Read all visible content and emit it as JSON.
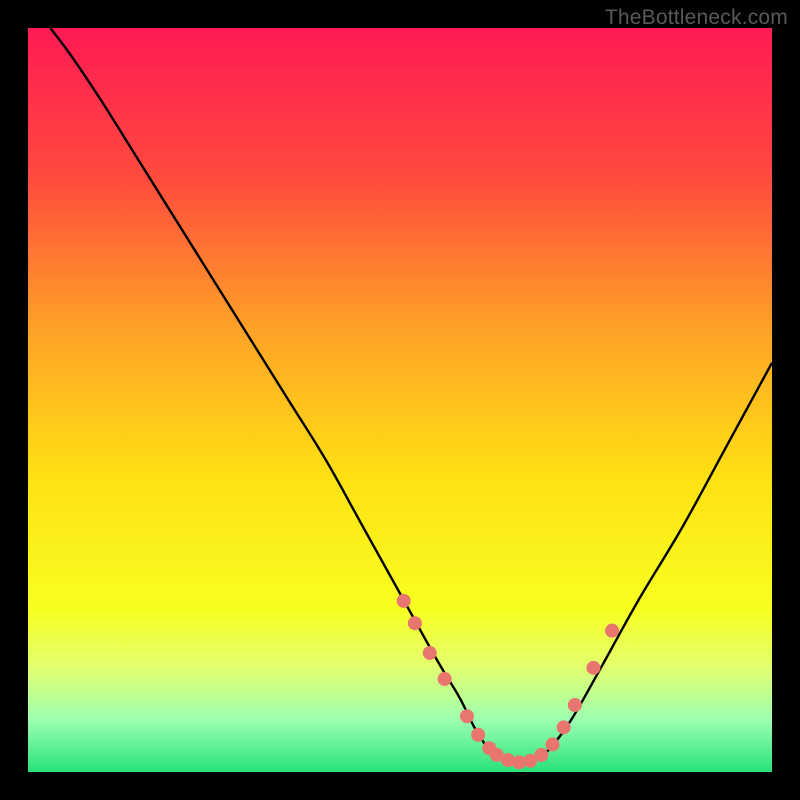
{
  "watermark": "TheBottleneck.com",
  "chart_data": {
    "type": "line",
    "title": "",
    "xlabel": "",
    "ylabel": "",
    "xlim": [
      0,
      100
    ],
    "ylim": [
      0,
      100
    ],
    "grid": false,
    "legend": false,
    "gradient_stops": [
      {
        "offset": 0,
        "color": "#ff1a54"
      },
      {
        "offset": 20,
        "color": "#ff4a3e"
      },
      {
        "offset": 40,
        "color": "#ffa028"
      },
      {
        "offset": 60,
        "color": "#ffe014"
      },
      {
        "offset": 78,
        "color": "#f8ff20"
      },
      {
        "offset": 86,
        "color": "#e2ff70"
      },
      {
        "offset": 93,
        "color": "#9cffb0"
      },
      {
        "offset": 100,
        "color": "#29e27a"
      }
    ],
    "series": [
      {
        "name": "bottleneck-curve",
        "x": [
          3,
          6,
          10,
          15,
          20,
          25,
          30,
          35,
          40,
          45,
          50,
          55,
          58,
          60,
          62,
          64,
          66,
          68,
          70,
          73,
          77,
          82,
          88,
          94,
          100
        ],
        "y": [
          100,
          96,
          90,
          82,
          74,
          66,
          58,
          50,
          42,
          33,
          24,
          15,
          10,
          6,
          3,
          1.5,
          1,
          1.5,
          3,
          7,
          14,
          23,
          33,
          44,
          55
        ]
      }
    ],
    "markers": {
      "name": "highlight-dots",
      "color": "#e8766f",
      "radius": 7,
      "x": [
        50.5,
        52,
        54,
        56,
        59,
        60.5,
        62,
        63,
        64.5,
        66,
        67.5,
        69,
        70.5,
        72,
        73.5,
        76,
        78.5
      ],
      "y": [
        23,
        20,
        16,
        12.5,
        7.5,
        5,
        3.2,
        2.3,
        1.6,
        1.3,
        1.5,
        2.3,
        3.7,
        6,
        9,
        14,
        19
      ]
    }
  }
}
